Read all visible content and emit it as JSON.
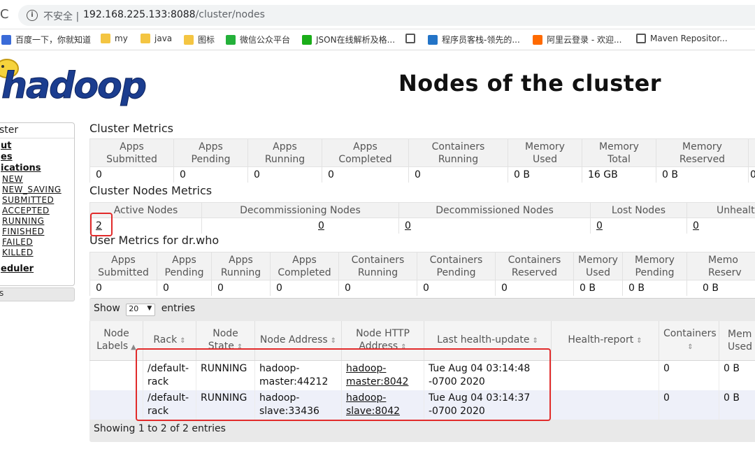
{
  "browser": {
    "security_label": "不安全 |",
    "url_host": "192.168.225.133:8088",
    "url_path": "/cluster/nodes",
    "bookmarks": [
      {
        "label": "百度一下，你就知道",
        "icon": "paw-icon"
      },
      {
        "label": "my",
        "icon": "folder-icon"
      },
      {
        "label": "java",
        "icon": "folder-icon"
      },
      {
        "label": "图标",
        "icon": "folder-icon"
      },
      {
        "label": "微信公众平台",
        "icon": "wechat-icon"
      },
      {
        "label": "JSON在线解析及格...",
        "icon": "json-icon"
      },
      {
        "label": "",
        "icon": "globe-icon"
      },
      {
        "label": "程序员客栈-领先的...",
        "icon": "blue-square-icon"
      },
      {
        "label": "阿里云登录 - 欢迎...",
        "icon": "aliyun-icon"
      },
      {
        "label": "Maven Repositor...",
        "icon": "globe-icon"
      }
    ]
  },
  "header": {
    "logo_text": "hadoop",
    "title": "Nodes of the cluster"
  },
  "nav": {
    "heading": "ster",
    "links": [
      "ut",
      "es",
      "ications"
    ],
    "states": [
      "NEW",
      "NEW_SAVING",
      "SUBMITTED",
      "ACCEPTED",
      "RUNNING",
      "FINISHED",
      "FAILED",
      "KILLED"
    ],
    "scheduler": "eduler",
    "tools": "s"
  },
  "cluster_metrics": {
    "title": "Cluster Metrics",
    "headers": [
      [
        "Apps",
        "Submitted"
      ],
      [
        "Apps",
        "Pending"
      ],
      [
        "Apps",
        "Running"
      ],
      [
        "Apps",
        "Completed"
      ],
      [
        "Containers",
        "Running"
      ],
      [
        "Memory",
        "Used"
      ],
      [
        "Memory",
        "Total"
      ],
      [
        "Memory",
        "Reserved"
      ],
      [
        "",
        ""
      ]
    ],
    "values": [
      "0",
      "0",
      "0",
      "0",
      "0",
      "0 B",
      "16 GB",
      "0 B",
      "0"
    ]
  },
  "cluster_nodes_metrics": {
    "title": "Cluster Nodes Metrics",
    "headers": [
      "Active Nodes",
      "Decommissioning Nodes",
      "Decommissioned Nodes",
      "Lost Nodes",
      "Unhealth"
    ],
    "values": [
      "2",
      "0",
      "0",
      "0",
      "0"
    ]
  },
  "user_metrics": {
    "title": "User Metrics for dr.who",
    "headers": [
      [
        "Apps",
        "Submitted"
      ],
      [
        "Apps",
        "Pending"
      ],
      [
        "Apps",
        "Running"
      ],
      [
        "Apps",
        "Completed"
      ],
      [
        "Containers",
        "Running"
      ],
      [
        "Containers",
        "Pending"
      ],
      [
        "Containers",
        "Reserved"
      ],
      [
        "Memory",
        "Used"
      ],
      [
        "Memory",
        "Pending"
      ],
      [
        "Memo",
        "Reserv"
      ]
    ],
    "values": [
      "0",
      "0",
      "0",
      "0",
      "0",
      "0",
      "0",
      "0 B",
      "0 B",
      "0 B"
    ]
  },
  "nodes_table": {
    "show_label": "Show",
    "page_size": "20",
    "entries_label": "entries",
    "headers": [
      [
        "Node",
        "Labels"
      ],
      [
        "Rack",
        ""
      ],
      [
        "Node",
        "State"
      ],
      [
        "Node Address",
        ""
      ],
      [
        "Node HTTP",
        "Address"
      ],
      [
        "Last health-update",
        ""
      ],
      [
        "Health-report",
        ""
      ],
      [
        "Containers",
        ""
      ],
      [
        "Mem",
        "Used"
      ]
    ],
    "rows": [
      {
        "labels": "",
        "rack": [
          "/default-",
          "rack"
        ],
        "state": "RUNNING",
        "address": [
          "hadoop-",
          "master:44212"
        ],
        "http": [
          "hadoop-",
          "master:8042"
        ],
        "health_update": [
          "Tue Aug 04 03:14:48",
          "-0700 2020"
        ],
        "health_report": "",
        "containers": "0",
        "mem_used": "0 B"
      },
      {
        "labels": "",
        "rack": [
          "/default-",
          "rack"
        ],
        "state": "RUNNING",
        "address": [
          "hadoop-",
          "slave:33436"
        ],
        "http": [
          "hadoop-",
          "slave:8042"
        ],
        "health_update": [
          "Tue Aug 04 03:14:37",
          "-0700 2020"
        ],
        "health_report": "",
        "containers": "0",
        "mem_used": "0 B"
      }
    ],
    "footer": "Showing 1 to 2 of 2 entries"
  },
  "colors": {
    "annotation_red": "#e12b2b",
    "logo_blue": "#1b3d8f",
    "logo_yellow": "#f6d33c"
  }
}
